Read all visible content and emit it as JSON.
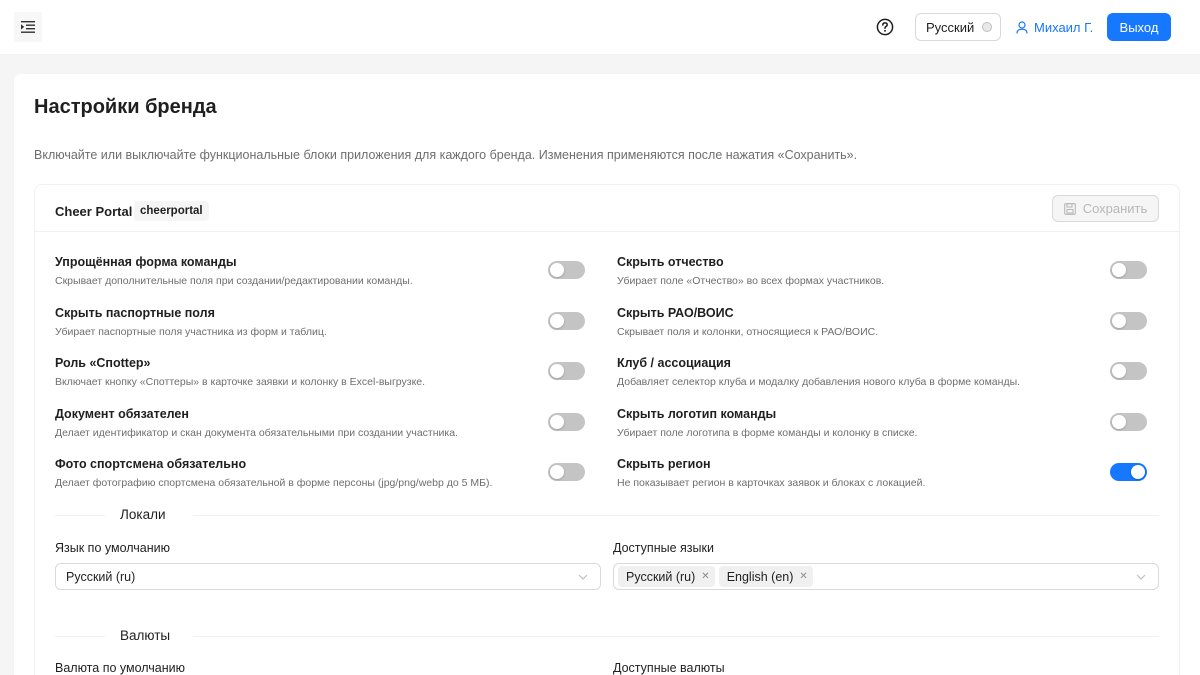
{
  "header": {
    "language": "Русский",
    "user_name": "Михаил Г.",
    "logout_label": "Выход"
  },
  "page": {
    "title": "Настройки бренда",
    "description": "Включайте или выключайте функциональные блоки приложения для каждого бренда. Изменения применяются после нажатия «Сохранить»."
  },
  "brand": {
    "name": "Cheer Portal",
    "slug": "cheerportal",
    "save_label": "Сохранить"
  },
  "settings": [
    {
      "title": "Упрощённая форма команды",
      "desc": "Скрывает дополнительные поля при создании/редактировании команды.",
      "enabled": false
    },
    {
      "title": "Скрыть отчество",
      "desc": "Убирает поле «Отчество» во всех формах участников.",
      "enabled": false
    },
    {
      "title": "Скрыть паспортные поля",
      "desc": "Убирает паспортные поля участника из форм и таблиц.",
      "enabled": false
    },
    {
      "title": "Скрыть РАО/ВОИС",
      "desc": "Скрывает поля и колонки, относящиеся к РАО/ВОИС.",
      "enabled": false
    },
    {
      "title": "Роль «Спottер»",
      "desc": "Включает кнопку «Споттеры» в карточке заявки и колонку в Excel-выгрузке.",
      "enabled": false
    },
    {
      "title": "Клуб / ассоциация",
      "desc": "Добавляет селектор клуба и модалку добавления нового клуба в форме команды.",
      "enabled": false
    },
    {
      "title": "Документ обязателен",
      "desc": "Делает идентификатор и скан документа обязательными при создании участника.",
      "enabled": false
    },
    {
      "title": "Скрыть логотип команды",
      "desc": "Убирает поле логотипа в форме команды и колонку в списке.",
      "enabled": false
    },
    {
      "title": "Фото спортсмена обязательно",
      "desc": "Делает фотографию спортсмена обязательной в форме персоны (jpg/png/webp до 5 МБ).",
      "enabled": false
    },
    {
      "title": "Скрыть регион",
      "desc": "Не показывает регион в карточках заявок и блоках с локацией.",
      "enabled": true
    }
  ],
  "locales": {
    "section_label": "Локали",
    "default_label": "Язык по умолчанию",
    "default_value": "Русский (ru)",
    "available_label": "Доступные языки",
    "available": [
      "Русский (ru)",
      "English (en)"
    ]
  },
  "currencies": {
    "section_label": "Валюты",
    "default_label": "Валюта по умолчанию",
    "available_label": "Доступные валюты"
  },
  "colors": {
    "primary": "#1677ff",
    "switch_off": "#c4c4c4"
  }
}
